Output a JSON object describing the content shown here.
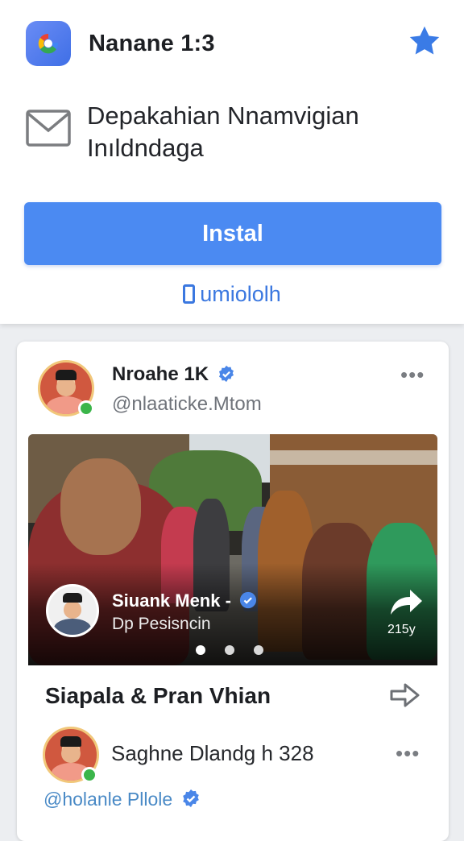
{
  "banner": {
    "app_title": "Nanane 1:3",
    "app_icon": "g-logo-icon",
    "star_icon": "star-icon",
    "mail_line1": "Depakahian Nnamvigian",
    "mail_line2": "Inıldndaga",
    "install_label": "Instal",
    "secondary_label": "umiololh"
  },
  "post": {
    "author_name": "Nroahe 1K",
    "author_handle": "@nlaaticke.Mtom",
    "media": {
      "overlay_name": "Siuank Menk -",
      "overlay_sub": "Dp Pesisncin",
      "time": "215y",
      "slide_count": 3,
      "active_slide": 1
    },
    "title": "Siapala & Pran Vhian",
    "comment": {
      "name": "Saghne Dlandg h 328",
      "handle": "@holanle Pllole"
    }
  },
  "colors": {
    "accent": "#4b8af2",
    "link": "#3b78e0",
    "star": "#3a7be6",
    "verified": "#4a86e8",
    "online": "#3bb54a"
  }
}
